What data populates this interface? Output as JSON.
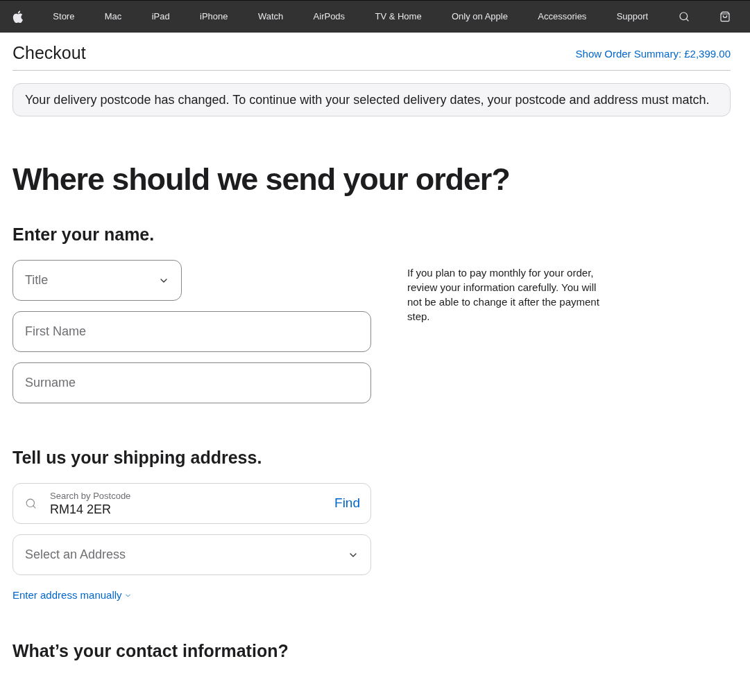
{
  "nav": {
    "items": [
      "Store",
      "Mac",
      "iPad",
      "iPhone",
      "Watch",
      "AirPods",
      "TV & Home",
      "Only on Apple",
      "Accessories",
      "Support"
    ]
  },
  "header": {
    "title": "Checkout",
    "summary_link": "Show Order Summary: £2,399.00"
  },
  "alert": "Your delivery postcode has changed. To continue with your selected delivery dates, your postcode and address must match.",
  "heading": "Where should we send your order?",
  "name_section": {
    "heading": "Enter your name.",
    "title_select": {
      "placeholder": "Title"
    },
    "first_name": {
      "placeholder": "First Name"
    },
    "surname": {
      "placeholder": "Surname"
    },
    "note": "If you plan to pay monthly for your order, review your information carefully. You will not be able to change it after the payment step."
  },
  "address_section": {
    "heading": "Tell us your shipping address.",
    "postcode": {
      "label": "Search by Postcode",
      "value": "RM14 2ER",
      "button": "Find"
    },
    "address_select": {
      "placeholder": "Select an Address"
    },
    "manual_link": "Enter address manually"
  },
  "contact_section": {
    "heading": "What’s your contact information?"
  }
}
